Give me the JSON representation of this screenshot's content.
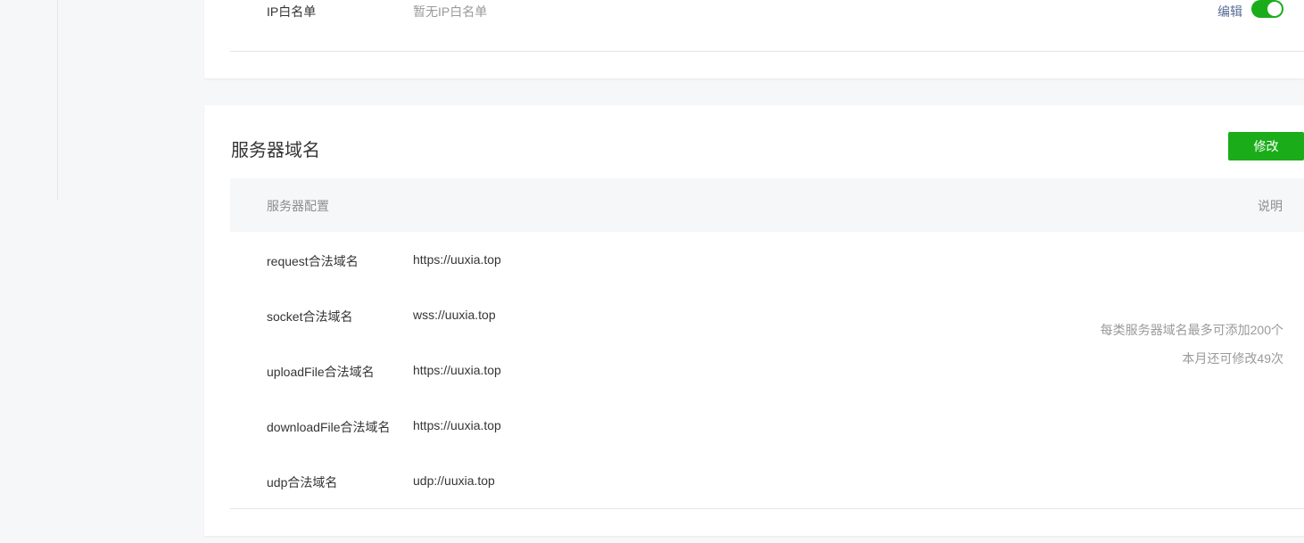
{
  "colors": {
    "accent_green": "#1aad19",
    "link_blue": "#576b95",
    "text_primary": "#353535",
    "text_muted": "#9a9a9a"
  },
  "ip_whitelist": {
    "label": "IP白名单",
    "value": "暂无IP白名单",
    "edit_label": "编辑",
    "toggle_on": true
  },
  "server_domain": {
    "title": "服务器域名",
    "modify_label": "修改",
    "header": {
      "config": "服务器配置",
      "note": "说明"
    },
    "rows": [
      {
        "label": "request合法域名",
        "value": "https://uuxia.top"
      },
      {
        "label": "socket合法域名",
        "value": "wss://uuxia.top"
      },
      {
        "label": "uploadFile合法域名",
        "value": "https://uuxia.top"
      },
      {
        "label": "downloadFile合法域名",
        "value": "https://uuxia.top"
      },
      {
        "label": "udp合法域名",
        "value": "udp://uuxia.top"
      }
    ],
    "note": {
      "line1": "每类服务器域名最多可添加200个",
      "line2": "本月还可修改49次"
    }
  }
}
